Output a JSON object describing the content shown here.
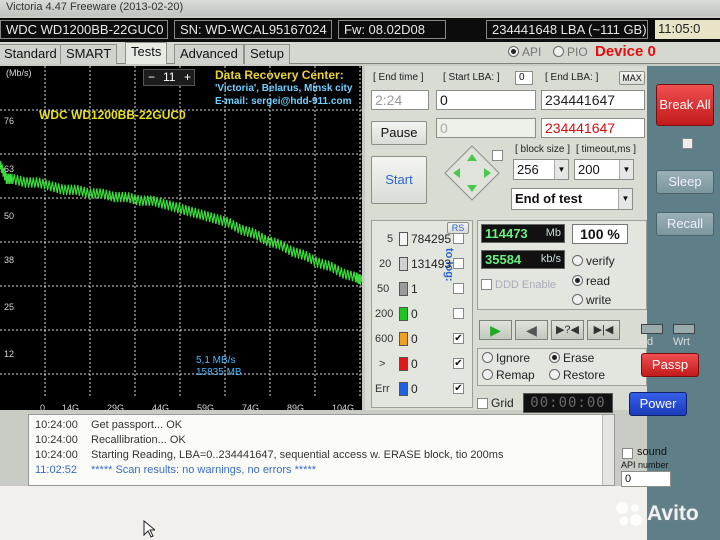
{
  "window": {
    "title": "Victoria 4.47 Freeware (2013-02-20)"
  },
  "header": {
    "model": "WDC WD1200BB-22GUC0",
    "serial": "SN: WD-WCAL95167024",
    "firmware": "Fw: 08.02D08",
    "lba": "234441648 LBA (~111 GB)",
    "clock": "11:05:0"
  },
  "tabs": [
    "Standard",
    "SMART",
    "Tests",
    "Advanced",
    "Setup"
  ],
  "active_tab": "Tests",
  "mode": {
    "api": "API",
    "pio": "PIO",
    "selected": "API"
  },
  "device_label": "Device 0",
  "graph": {
    "units": "(Mb/s)",
    "drive_label": "WDC WD1200BB-22GUC0",
    "speed_scale": "11",
    "speed_minus": "−",
    "speed_plus": "+",
    "recovery": {
      "line1": "Data Recovery Center:",
      "line2": "'Victoria', Belarus, Minsk city",
      "line3": "E-mail: sergei@hdd-911.com"
    },
    "current_speed": "5,1 MB/s",
    "current_size": "15835 MB",
    "y_ticks": [
      "76",
      "63",
      "50",
      "38",
      "25",
      "12"
    ],
    "x_ticks": [
      "0",
      "14G",
      "29G",
      "44G",
      "59G",
      "74G",
      "89G",
      "104G"
    ],
    "line_color": "#3ddc3d"
  },
  "chart_data": {
    "type": "line",
    "xlabel": "",
    "ylabel": "(Mb/s)",
    "xlim": [
      0,
      114
    ],
    "ylim": [
      0,
      89
    ],
    "x_ticks": [
      "0",
      "14G",
      "29G",
      "44G",
      "59G",
      "74G",
      "89G",
      "104G"
    ],
    "y_ticks": [
      76,
      63,
      50,
      38,
      25,
      12
    ],
    "series": [
      {
        "name": "",
        "x": [
          0,
          2,
          4,
          8,
          12,
          16,
          20,
          24,
          28,
          32,
          36,
          40,
          44,
          48,
          52,
          56,
          60,
          64,
          68,
          72,
          76,
          80,
          84,
          88,
          92,
          96,
          100,
          104,
          108,
          112,
          114
        ],
        "y": [
          64,
          60,
          60,
          59,
          59,
          58,
          57,
          57,
          56,
          56,
          55,
          55,
          54,
          54,
          53,
          52,
          51,
          50,
          49,
          48,
          46,
          45,
          43,
          42,
          40,
          39,
          37,
          36,
          34,
          33,
          32
        ]
      }
    ]
  },
  "controls": {
    "end_time_label": "[ End time ]",
    "end_time_value": "2:24",
    "start_lba_label": "[ Start LBA: ]",
    "start_lba_zero": "0",
    "start_lba_value": "0",
    "start_lba_value2": "0",
    "end_lba_label": "[ End LBA: ]",
    "max_label": "MAX",
    "end_lba_value": "234441647",
    "end_lba_value2": "234441647",
    "pause_label": "Pause",
    "start_label": "Start",
    "block_size_label": "[ block size ]",
    "block_size_value": "256",
    "timeout_label": "[ timeout,ms ]",
    "timeout_value": "200",
    "end_action_value": "End of test"
  },
  "blocks": {
    "rs_label": "RS",
    "to_log_label": "to log:",
    "rows": [
      {
        "label": "5",
        "count": "784295",
        "color": "#f4f4f4"
      },
      {
        "label": "20",
        "count": "131493",
        "color": "#d0d0d0"
      },
      {
        "label": "50",
        "count": "1",
        "color": "#9a9a9a"
      },
      {
        "label": "200",
        "count": "0",
        "color": "#22c422"
      },
      {
        "label": "600",
        "count": "0",
        "color": "#f0a020"
      },
      {
        "label": ">",
        "count": "0",
        "color": "#e01818"
      },
      {
        "label": "Err",
        "count": "0",
        "color": "#2060e0"
      }
    ]
  },
  "stats": {
    "mb_value": "114473",
    "mb_unit": "Mb",
    "percent": "100 %",
    "speed_value": "35584",
    "speed_unit": "kb/s",
    "ddd_label": "DDD Enable",
    "verify_label": "verify",
    "read_label": "read",
    "write_label": "write",
    "selected_mode": "read"
  },
  "actions": {
    "ignore": "Ignore",
    "erase": "Erase",
    "remap": "Remap",
    "restore": "Restore",
    "selected": "Erase",
    "grid_label": "Grid",
    "timer": "00:00:00"
  },
  "sidebar": {
    "break_all": "Break All",
    "sleep": "Sleep",
    "recall": "Recall",
    "rd": "Rd",
    "wrt": "Wrt",
    "passp": "Passp",
    "power": "Power",
    "sound": "sound",
    "api_number_label": "API number",
    "api_number_value": "0"
  },
  "log": [
    {
      "time": "10:24:00",
      "text": "Get passport... OK"
    },
    {
      "time": "10:24:00",
      "text": "Recallibration... OK"
    },
    {
      "time": "10:24:00",
      "text": "Starting Reading, LBA=0..234441647, sequential access w. ERASE block, tio 200ms"
    },
    {
      "time": "11:02:52",
      "text": "***** Scan results: no warnings, no errors *****"
    }
  ],
  "watermark": "Avito"
}
